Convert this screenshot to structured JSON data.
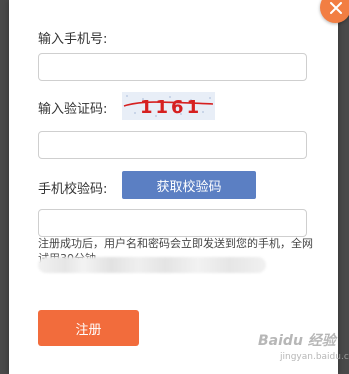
{
  "dialog": {
    "phone_label": "输入手机号:",
    "phone_value": "",
    "captcha_label": "输入验证码:",
    "captcha_text": "1161",
    "captcha_value": "",
    "sms_label": "手机校验码:",
    "sms_button_label": "获取校验码",
    "sms_value": "",
    "notice": "注册成功后，用户名和密码会立即发送到您的手机，全网试用30分钟。",
    "register_label": "注册"
  },
  "watermark": {
    "logo": "Baidu 经验",
    "url": "jingyan.baidu.com"
  },
  "colors": {
    "accent_orange": "#f26c3c",
    "close_orange": "#f27e43",
    "sms_blue": "#5b7fc3",
    "captcha_red": "#d62020"
  }
}
